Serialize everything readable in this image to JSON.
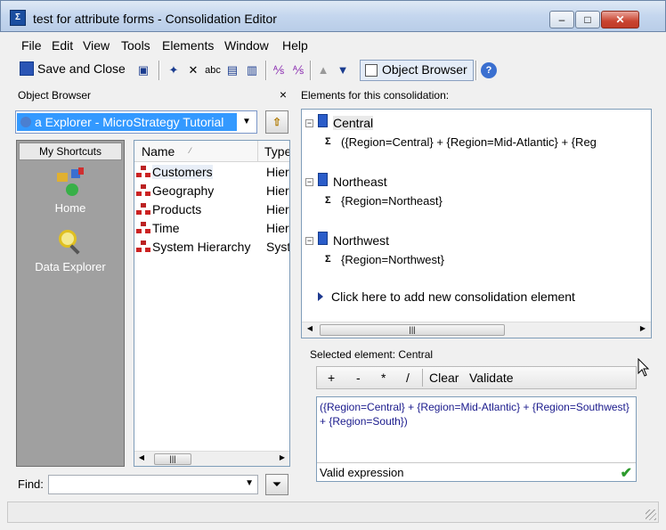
{
  "window": {
    "title": "test for attribute forms - Consolidation Editor",
    "app_icon": "Σ",
    "minimize": "–",
    "maximize": "□",
    "close": "✕"
  },
  "menu": [
    "File",
    "Edit",
    "View",
    "Tools",
    "Elements",
    "Window",
    "Help"
  ],
  "toolbar": {
    "save_close": "Save and Close",
    "object_browser": "Object Browser"
  },
  "object_browser": {
    "title": "Object Browser",
    "close": "×",
    "project": "a Explorer - MicroStrategy Tutorial",
    "shortcuts_header": "My Shortcuts",
    "shortcuts": [
      "Home",
      "Data Explorer"
    ],
    "columns": [
      "Name",
      "Type"
    ],
    "items": [
      {
        "name": "Customers",
        "type": "Hier"
      },
      {
        "name": "Geography",
        "type": "Hier"
      },
      {
        "name": "Products",
        "type": "Hier"
      },
      {
        "name": "Time",
        "type": "Hier"
      },
      {
        "name": "System Hierarchy",
        "type": "Syste"
      }
    ],
    "find_label": "Find:",
    "find_value": ""
  },
  "elements": {
    "label": "Elements for this consolidation:",
    "groups": [
      {
        "name": "Central",
        "expr": "({Region=Central}  +  {Region=Mid-Atlantic}  +  {Reg"
      },
      {
        "name": "Northeast",
        "expr": "{Region=Northeast}"
      },
      {
        "name": "Northwest",
        "expr": "{Region=Northwest}"
      }
    ],
    "add_new": "Click here to add new consolidation element"
  },
  "selected": {
    "label": "Selected element: Central",
    "operators": [
      "+",
      "-",
      "*",
      "/"
    ],
    "clear": "Clear",
    "validate": "Validate",
    "expression": "({Region=Central}  +  {Region=Mid-Atlantic}  +  {Region=Southwest}  +  {Region=South})",
    "status": "Valid expression"
  }
}
